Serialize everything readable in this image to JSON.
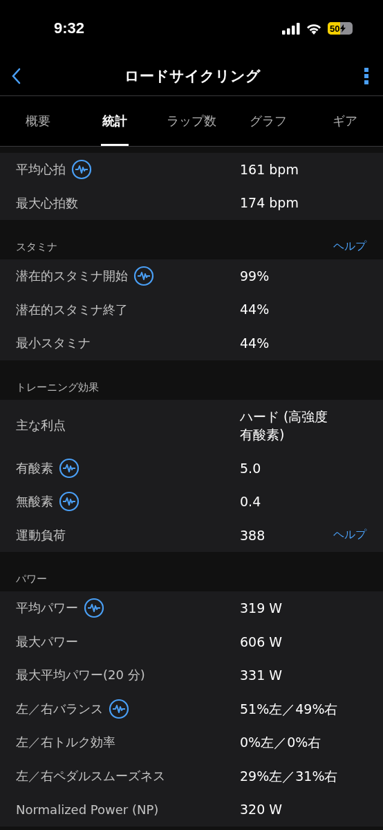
{
  "status_bar": {
    "time": "9:32",
    "battery": {
      "text": "50",
      "level": 0.5,
      "charging": true
    }
  },
  "nav": {
    "title": "ロードサイクリング"
  },
  "tabs": [
    {
      "label": "概要",
      "selected": false
    },
    {
      "label": "統計",
      "selected": true
    },
    {
      "label": "ラップ数",
      "selected": false
    },
    {
      "label": "グラフ",
      "selected": false
    },
    {
      "label": "ギア",
      "selected": false
    }
  ],
  "sections": [
    {
      "rows": [
        {
          "label": "平均心拍",
          "value": "161 bpm",
          "chart_icon": true
        },
        {
          "label": "最大心拍数",
          "value": "174 bpm",
          "chart_icon": false
        }
      ]
    },
    {
      "title": "スタミナ",
      "help": "ヘルプ",
      "rows": [
        {
          "label": "潜在的スタミナ開始",
          "value": "99%",
          "chart_icon": true
        },
        {
          "label": "潜在的スタミナ終了",
          "value": "44%",
          "chart_icon": false
        },
        {
          "label": "最小スタミナ",
          "value": "44%",
          "chart_icon": false
        }
      ]
    },
    {
      "title": "トレーニング効果",
      "rows": [
        {
          "label": "主な利点",
          "value": "ハード (高強度有酸素)",
          "chart_icon": false
        },
        {
          "label": "有酸素",
          "value": "5.0",
          "chart_icon": true
        },
        {
          "label": "無酸素",
          "value": "0.4",
          "chart_icon": true
        },
        {
          "label": "運動負荷",
          "value": "388",
          "chart_icon": false,
          "help": "ヘルプ"
        }
      ]
    },
    {
      "title": "パワー",
      "rows": [
        {
          "label": "平均パワー",
          "value": "319 W",
          "chart_icon": true
        },
        {
          "label": "最大パワー",
          "value": "606 W",
          "chart_icon": false
        },
        {
          "label": "最大平均パワー(20 分)",
          "value": "331 W",
          "chart_icon": false
        },
        {
          "label": "左／右バランス",
          "value": "51%左／49%右",
          "chart_icon": true
        },
        {
          "label": "左／右トルク効率",
          "value": "0%左／0%右",
          "chart_icon": false
        },
        {
          "label": "左／右ペダルスムーズネス",
          "value": "29%左／31%右",
          "chart_icon": false
        },
        {
          "label": "Normalized Power (NP)",
          "value": "320 W",
          "chart_icon": false
        }
      ]
    }
  ]
}
